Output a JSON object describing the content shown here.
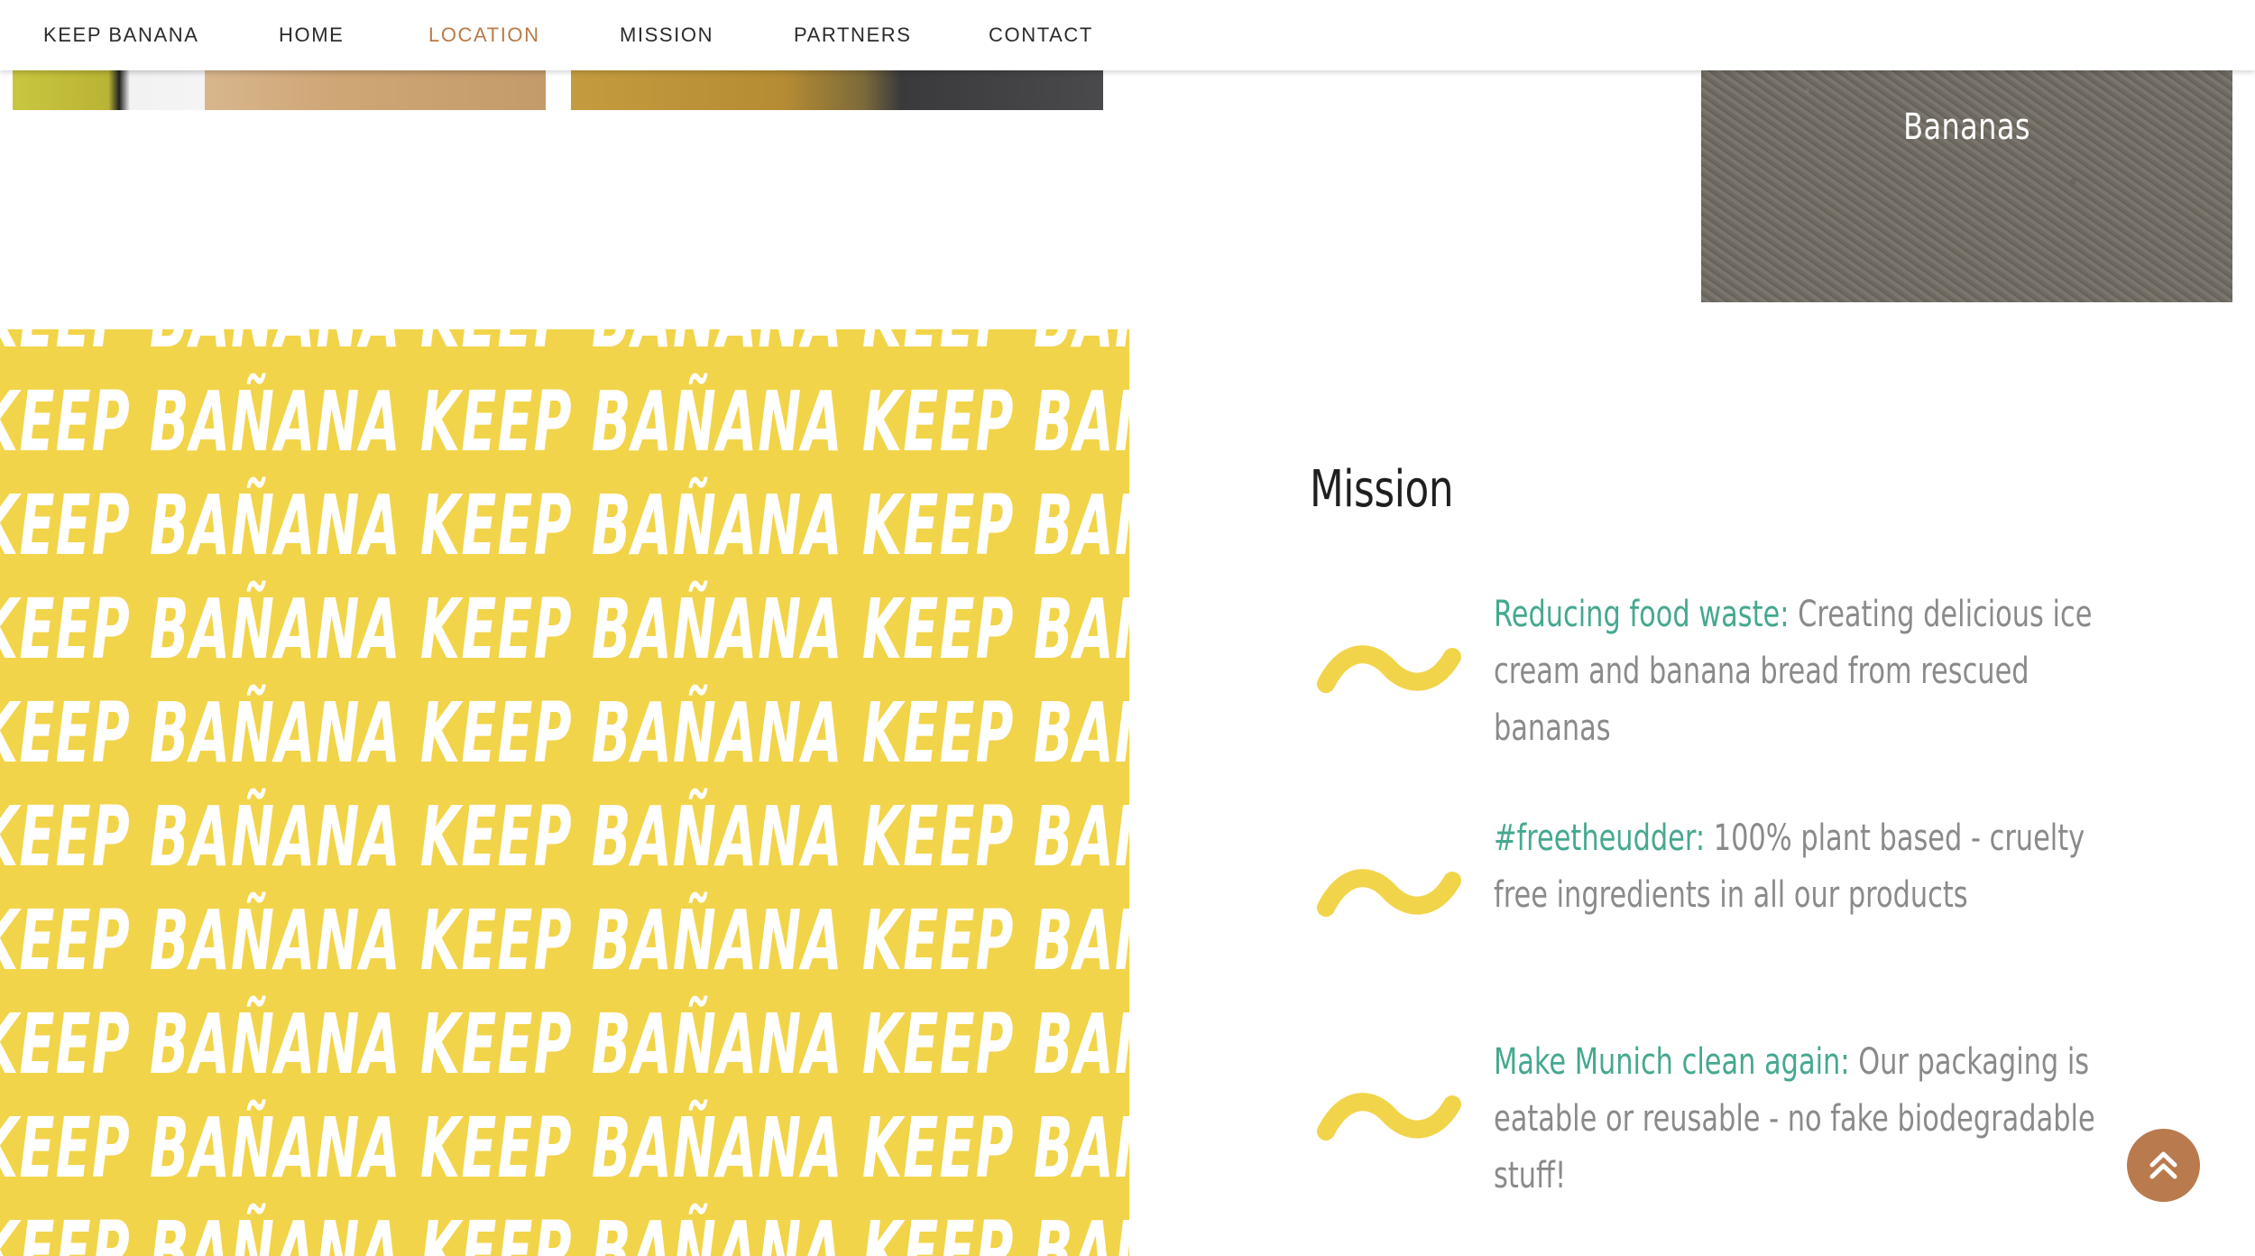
{
  "nav": {
    "brand": "KEEP BANANA",
    "items": [
      {
        "label": "HOME",
        "active": false
      },
      {
        "label": "LOCATION",
        "active": true
      },
      {
        "label": "MISSION",
        "active": false
      },
      {
        "label": "PARTNERS",
        "active": false
      },
      {
        "label": "CONTACT",
        "active": false
      }
    ],
    "active_color": "#b97a47"
  },
  "gallery": {
    "caption": "Bananas"
  },
  "pattern": {
    "text": "KEEP BAÑANA",
    "background_color": "#f2d44a"
  },
  "mission": {
    "title": "Mission",
    "items": [
      {
        "highlight": "Reducing food waste:",
        "text": " Creating delicious ice cream and banana bread from rescued bananas",
        "icon": "tilde-icon"
      },
      {
        "highlight": "#freetheudder:",
        "text": " 100% plant based - cruelty free ingredients in all our products",
        "icon": "tilde-icon"
      },
      {
        "highlight": "Make Munich clean again:",
        "text": " Our packaging is eatable or reusable - no fake biodegradable stuff!",
        "icon": "tilde-icon"
      }
    ],
    "highlight_color": "#45a890",
    "icon_color": "#f2d44a"
  },
  "scroll_top": {
    "icon": "double-chevron-up-icon",
    "color": "#b97a4d"
  }
}
